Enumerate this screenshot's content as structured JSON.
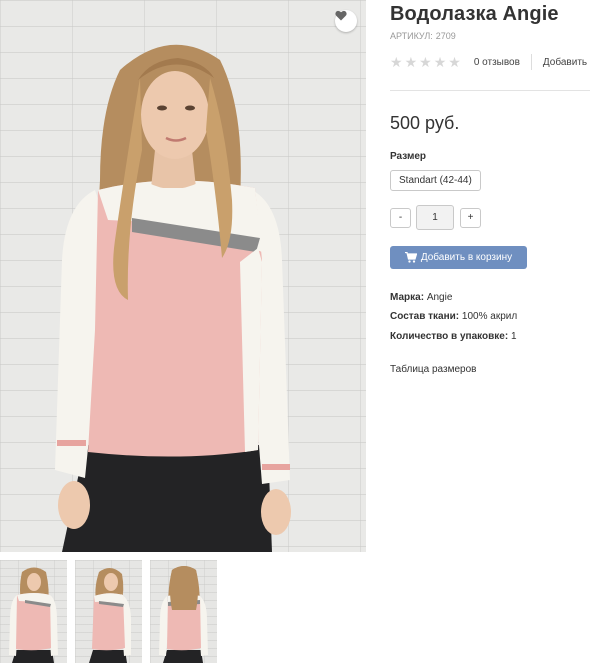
{
  "product": {
    "title": "Водолазка Angie",
    "sku_label": "АРТИКУЛ:",
    "sku_value": "2709",
    "rating": 0,
    "rating_max": 5,
    "reviews_text": "0 отзывов",
    "add_review_text": "Добавить отзыв",
    "price": "500 руб."
  },
  "options": {
    "size_label": "Размер",
    "size_value": "Standart (42-44)"
  },
  "quantity": {
    "minus_label": "-",
    "value": "1",
    "plus_label": "+"
  },
  "cart": {
    "button_label": "Добавить в корзину",
    "icon": "cart-icon"
  },
  "attributes": [
    {
      "label": "Марка:",
      "value": "Angie"
    },
    {
      "label": "Состав ткани:",
      "value": "100% акрил"
    },
    {
      "label": "Количество в упаковке:",
      "value": "1"
    }
  ],
  "links": {
    "size_table": "Таблица размеров"
  },
  "icons": {
    "wishlist": "heart-icon",
    "star": "star-icon"
  },
  "colors": {
    "cart_button": "#6f8fc0",
    "star_empty": "#d7d7d7",
    "sweater_pink": "#eeb9b4",
    "sweater_white": "#f6f4ee"
  }
}
